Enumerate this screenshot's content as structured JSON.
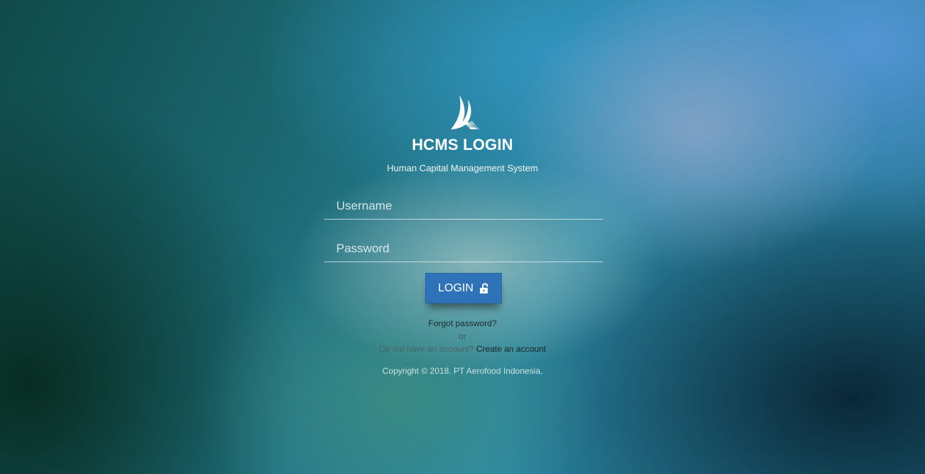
{
  "header": {
    "logo_icon": "aerofood-logo-icon",
    "title": "HCMS LOGIN",
    "subtitle": "Human Capital Management System"
  },
  "form": {
    "username_placeholder": "Username",
    "username_value": "",
    "password_placeholder": "Password",
    "password_value": "",
    "login_label": "LOGIN",
    "login_icon": "unlock-icon"
  },
  "links": {
    "forgot_password": "Forgot password?",
    "or": "or",
    "no_account": "Do not have an account?",
    "create_account": "Create an account"
  },
  "footer": {
    "copyright": "Copyright © 2018. PT Aerofood Indonesia."
  },
  "colors": {
    "button": "#2f72b7",
    "text_light": "#ffffff"
  }
}
